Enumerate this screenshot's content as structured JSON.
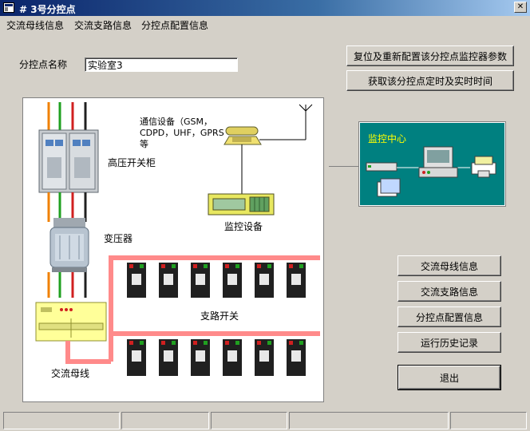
{
  "window": {
    "title": "# 3号分控点"
  },
  "menu": [
    "交流母线信息",
    "交流支路信息",
    "分控点配置信息"
  ],
  "field": {
    "label": "分控点名称",
    "value": "实验室3"
  },
  "top_buttons": {
    "reset_config": "复位及重新配置该分控点监控器参数",
    "get_time": "获取该分控点定时及实时时间"
  },
  "diagram": {
    "comm_device": "通信设备（GSM，CDPD，UHF，GPRS等",
    "hv_cabinet": "高压开关柜",
    "transformer": "变压器",
    "monitor_device": "监控设备",
    "branch_switch": "支路开关",
    "ac_bus": "交流母线"
  },
  "monitor_center": {
    "title": "监控中心"
  },
  "side_buttons": {
    "ac_bus_info": "交流母线信息",
    "ac_branch_info": "交流支路信息",
    "point_config_info": "分控点配置信息",
    "history": "运行历史记录",
    "exit": "退出"
  },
  "colors": {
    "title_bar": "#0a246a",
    "window_bg": "#d4d0c8",
    "bus_line": "#ff8a8a",
    "center_panel": "#008080",
    "center_title": "#ffff00"
  }
}
